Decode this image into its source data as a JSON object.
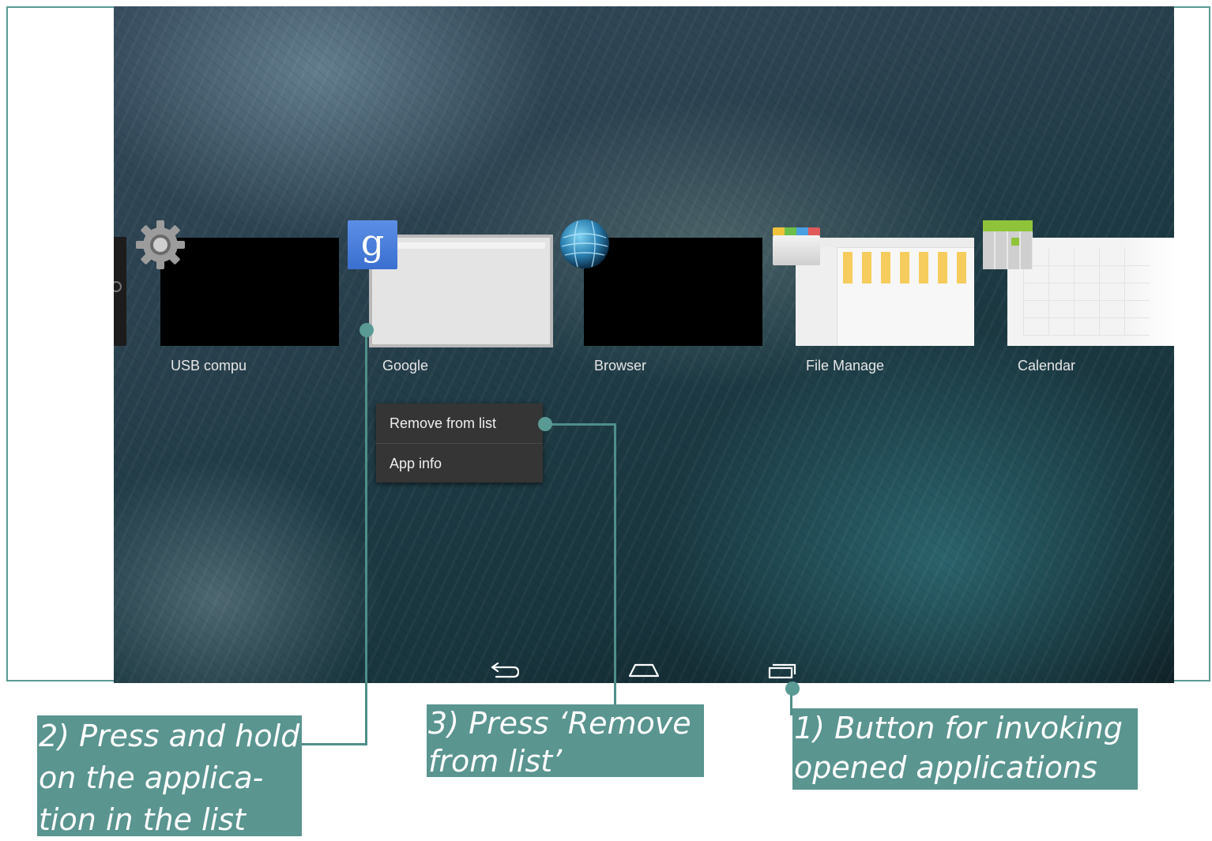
{
  "recents": {
    "apps": [
      {
        "label": "USB compu",
        "icon": "gear-icon"
      },
      {
        "label": "Google",
        "icon": "google-icon"
      },
      {
        "label": "Browser",
        "icon": "globe-icon"
      },
      {
        "label": "File Manage",
        "icon": "folder-icon"
      },
      {
        "label": "Calendar",
        "icon": "calendar-icon"
      }
    ]
  },
  "context_menu": {
    "items": [
      "Remove from list",
      "App info"
    ]
  },
  "navbar": {
    "back_icon": "back-icon",
    "home_icon": "home-icon",
    "recents_icon": "recent-apps-icon"
  },
  "callouts": {
    "step1": "1) Button for invoking opened applications",
    "step2": "2) Press and hold on the applica- tion in the list",
    "step3": "3) Press ‘Remove from list’"
  },
  "colors": {
    "accent": "#5a9590",
    "menu_bg": "#353535"
  }
}
